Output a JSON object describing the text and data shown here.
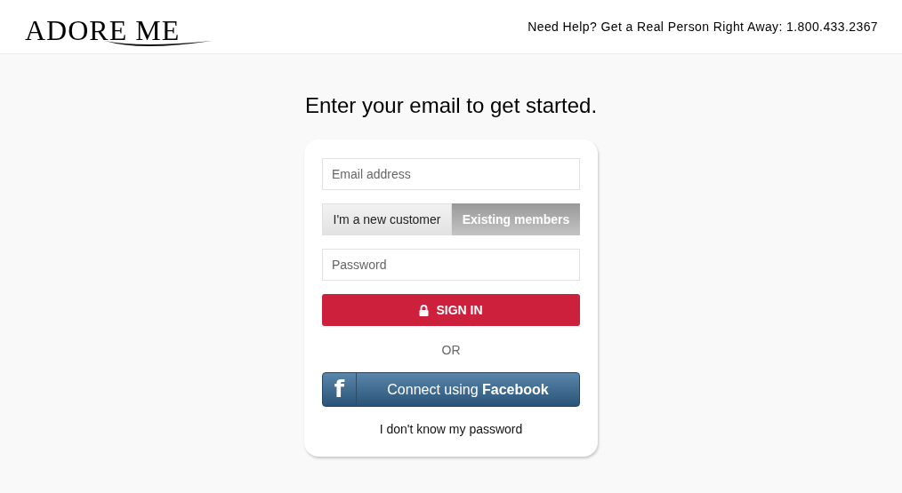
{
  "header": {
    "logo": "ADORE ME",
    "help": "Need Help? Get a Real Person Right Away: 1.800.433.2367"
  },
  "heading": "Enter your email to get started.",
  "form": {
    "email": {
      "placeholder": "Email address"
    },
    "toggle": [
      {
        "label": "I'm a new customer",
        "selected": false
      },
      {
        "label": "Existing members",
        "selected": true
      }
    ],
    "password": {
      "placeholder": "Password"
    },
    "sign_in": "SIGN IN",
    "or": "OR",
    "facebook": {
      "icon": "f",
      "label": "Connect using **Facebook**"
    },
    "forgot": "I don't know my password"
  }
}
